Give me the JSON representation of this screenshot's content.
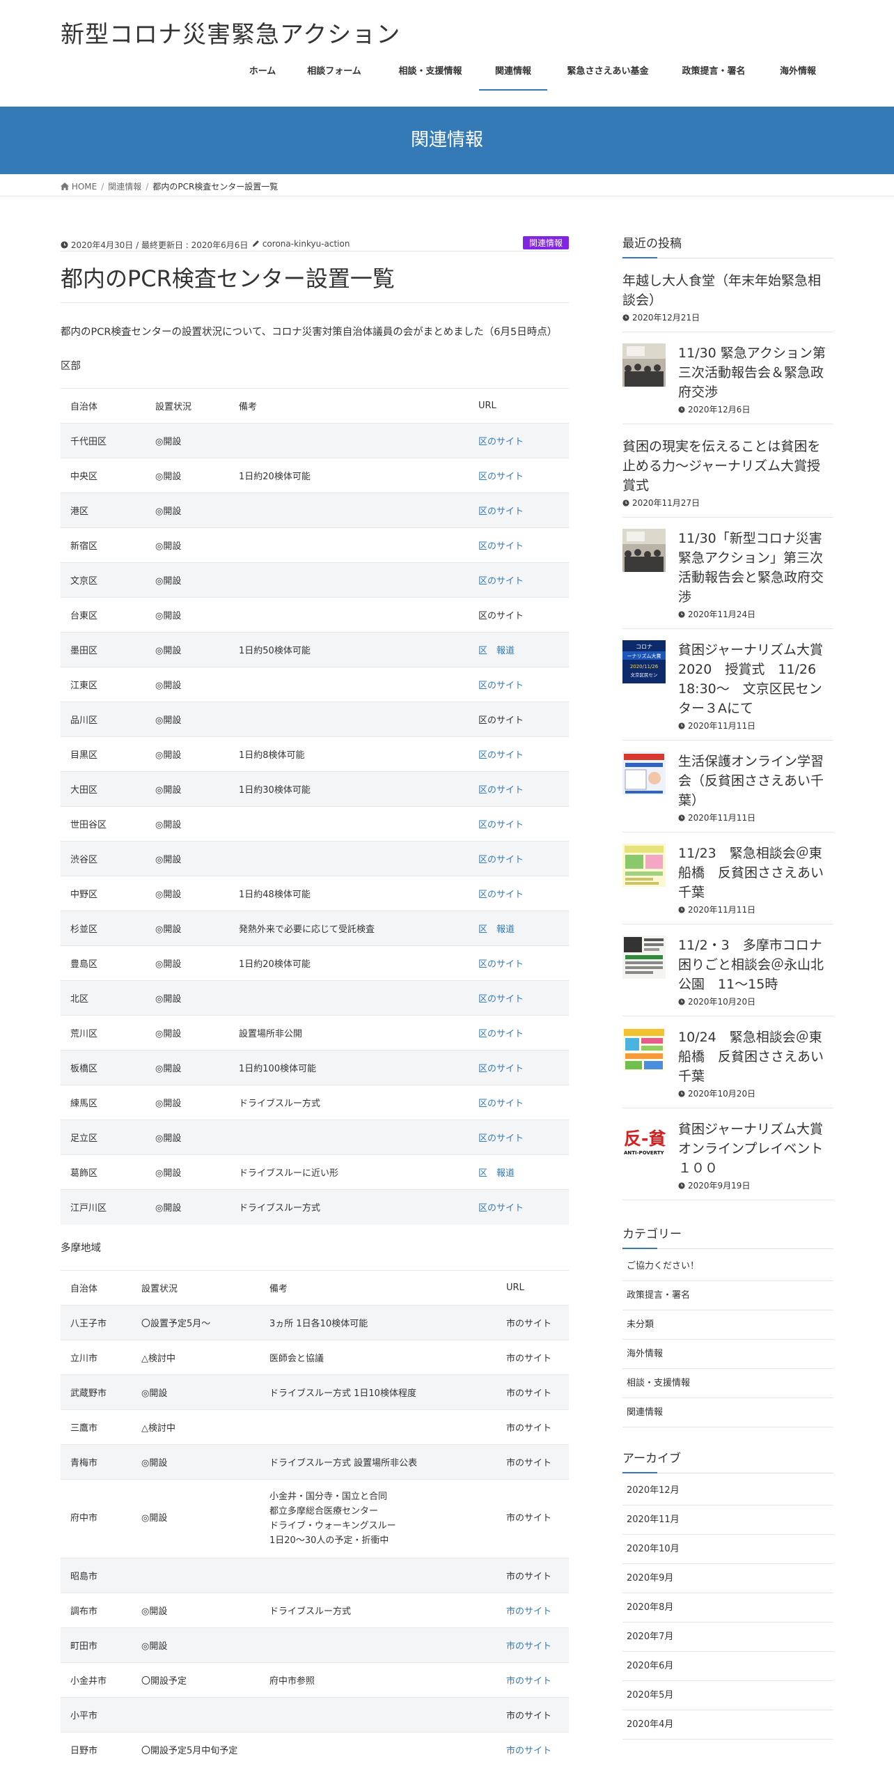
{
  "site": {
    "title": "新型コロナ災害緊急アクション"
  },
  "nav": [
    {
      "label": "ホーム"
    },
    {
      "label": "相談フォーム"
    },
    {
      "label": "相談・支援情報"
    },
    {
      "label": "関連情報"
    },
    {
      "label": "緊急ささえあい基金"
    },
    {
      "label": "政策提言・署名"
    },
    {
      "label": "海外情報"
    }
  ],
  "page_header": {
    "title": "関連情報"
  },
  "breadcrumb": {
    "home": "HOME",
    "parent": "関連情報",
    "current": "都内のPCR検査センター設置一覧"
  },
  "entry": {
    "meta_date": "2020年4月30日 / 最終更新日 : 2020年6月6日",
    "author": "corona-kinkyu-action",
    "category": "関連情報",
    "title": "都内のPCR検査センター設置一覧",
    "lead": "都内のPCR検査センターの設置状況について、コロナ災害対策自治体議員の会がまとめました（6月5日時点）"
  },
  "ku": {
    "label": "区部",
    "headers": [
      "自治体",
      "設置状況",
      "備考",
      "URL"
    ],
    "rows": [
      [
        "千代田区",
        "◎開設",
        "",
        "区のサイト"
      ],
      [
        "中央区",
        "◎開設",
        "1日約20検体可能",
        "区のサイト"
      ],
      [
        "港区",
        "◎開設",
        "",
        "区のサイト"
      ],
      [
        "新宿区",
        "◎開設",
        "",
        "区のサイト"
      ],
      [
        "文京区",
        "◎開設",
        "",
        "区のサイト"
      ],
      [
        "台東区",
        "◎開設",
        "",
        "区のサイト"
      ],
      [
        "墨田区",
        "◎開設",
        "1日約50検体可能",
        "区　報道"
      ],
      [
        "江東区",
        "◎開設",
        "",
        "区のサイト"
      ],
      [
        "品川区",
        "◎開設",
        "",
        "区のサイト"
      ],
      [
        "目黒区",
        "◎開設",
        "1日約8検体可能",
        "区のサイト"
      ],
      [
        "大田区",
        "◎開設",
        "1日約30検体可能",
        "区のサイト"
      ],
      [
        "世田谷区",
        "◎開設",
        "",
        "区のサイト"
      ],
      [
        "渋谷区",
        "◎開設",
        "",
        "区のサイト"
      ],
      [
        "中野区",
        "◎開設",
        "1日約48検体可能",
        "区のサイト"
      ],
      [
        "杉並区",
        "◎開設",
        "発熱外来で必要に応じて受託検査",
        "区　報道"
      ],
      [
        "豊島区",
        "◎開設",
        "1日約20検体可能",
        "区のサイト"
      ],
      [
        "北区",
        "◎開設",
        "",
        "区のサイト"
      ],
      [
        "荒川区",
        "◎開設",
        "設置場所非公開",
        "区のサイト"
      ],
      [
        "板橋区",
        "◎開設",
        "1日約100検体可能",
        "区のサイト"
      ],
      [
        "練馬区",
        "◎開設",
        "ドライブスルー方式",
        "区のサイト"
      ],
      [
        "足立区",
        "◎開設",
        "",
        "区のサイト"
      ],
      [
        "葛飾区",
        "◎開設",
        "ドライブスルーに近い形",
        "区　報道"
      ],
      [
        "江戸川区",
        "◎開設",
        "ドライブスルー方式",
        "区のサイト"
      ]
    ]
  },
  "tama": {
    "label": "多摩地域",
    "headers": [
      "自治体",
      "設置状況",
      "備考",
      "URL"
    ],
    "rows": [
      [
        "八王子市",
        "〇設置予定5月～",
        "3ヵ所 1日各10検体可能",
        "市のサイト"
      ],
      [
        "立川市",
        "△検討中",
        "医師会と協議",
        "市のサイト"
      ],
      [
        "武蔵野市",
        "◎開設",
        "ドライブスルー方式 1日10検体程度",
        "市のサイト"
      ],
      [
        "三鷹市",
        "△検討中",
        "",
        "市のサイト"
      ],
      [
        "青梅市",
        "◎開設",
        "ドライブスルー方式 設置場所非公表",
        "市のサイト"
      ],
      [
        "府中市",
        "◎開設",
        "小金井・国分寺・国立と合同",
        "市のサイト"
      ],
      [
        "昭島市",
        "",
        "",
        "市のサイト"
      ],
      [
        "調布市",
        "◎開設",
        "ドライブスルー方式",
        "市のサイト"
      ],
      [
        "町田市",
        "◎開設",
        "",
        "市のサイト"
      ],
      [
        "小金井市",
        "〇開設予定",
        "府中市参照",
        "市のサイト"
      ],
      [
        "小平市",
        "",
        "",
        "市のサイト"
      ],
      [
        "日野市",
        "〇開設予定5月中旬予定",
        "",
        "市のサイト"
      ]
    ],
    "fuchu_note_lines": [
      "小金井・国分寺・国立と合同",
      "都立多摩総合医療センター",
      "ドライブ・ウォーキングスルー",
      "1日20～30人の予定・折衝中"
    ]
  },
  "sidebar": {
    "recent_title": "最近の投稿",
    "posts": [
      {
        "title": "年越し大人食堂（年末年始緊急相談会）",
        "date": "2020年12月21日"
      },
      {
        "title": "11/30 緊急アクション第三次活動報告会＆緊急政府交渉",
        "date": "2020年12月6日"
      },
      {
        "title": "貧困の現実を伝えることは貧困を止める力〜ジャーナリズム大賞授賞式",
        "date": "2020年11月27日"
      },
      {
        "title": "11/30「新型コロナ災害緊急アクション」第三次活動報告会と緊急政府交渉",
        "date": "2020年11月24日"
      },
      {
        "title": "貧困ジャーナリズム大賞2020　授賞式　11/26 18:30～　文京区民センター３Aにて",
        "date": "2020年11月11日"
      },
      {
        "title": "生活保護オンライン学習会（反貧困ささえあい千葉）",
        "date": "2020年11月11日"
      },
      {
        "title": "11/23　緊急相談会＠東船橋　反貧困ささえあい千葉",
        "date": "2020年11月11日"
      },
      {
        "title": "11/2・3　多摩市コロナ困りごと相談会＠永山北公園　11～15時",
        "date": "2020年10月20日"
      },
      {
        "title": "10/24　緊急相談会＠東船橋　反貧困ささえあい千葉",
        "date": "2020年10月20日"
      },
      {
        "title": "貧困ジャーナリズム大賞オンラインプレイベント１００",
        "date": "2020年9月19日"
      }
    ],
    "category_title": "カテゴリー",
    "categories": [
      "ご協力ください！",
      "政策提言・署名",
      "未分類",
      "海外情報",
      "相談・支援情報",
      "関連情報"
    ],
    "archive_title": "アーカイブ",
    "archives": [
      "2020年12月",
      "2020年11月",
      "2020年10月",
      "2020年9月",
      "2020年8月",
      "2020年7月",
      "2020年6月",
      "2020年5月",
      "2020年4月"
    ],
    "thumb_texts": [
      "反-貧",
      "ANTI-POVERTY",
      "コロナ",
      "ーナリズム大賞",
      "2020/11/26",
      "文京区民セン"
    ]
  },
  "colors": {
    "primary": "#337ab7",
    "category_badge": "#8224e3",
    "row_stripe": "#f4f5f7"
  }
}
